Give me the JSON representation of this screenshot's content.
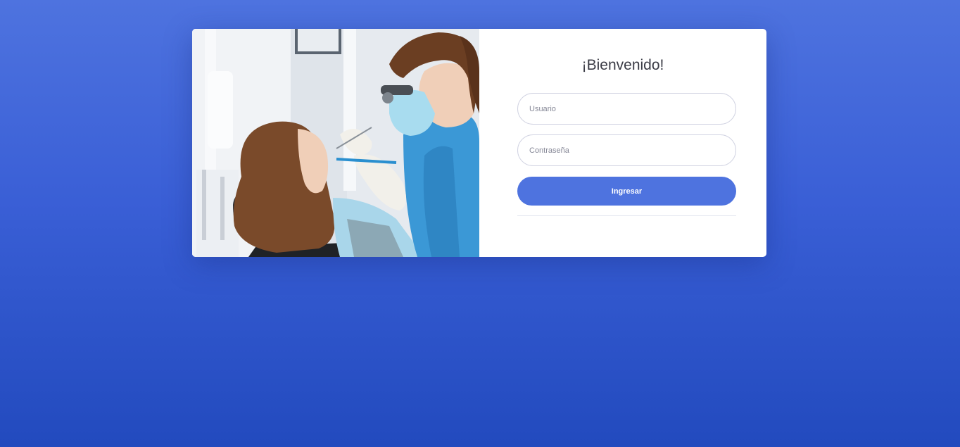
{
  "login": {
    "title": "¡Bienvenido!",
    "username_placeholder": "Usuario",
    "username_value": "",
    "password_placeholder": "Contraseña",
    "password_value": "",
    "submit_label": "Ingresar"
  },
  "image": {
    "subject": "dentist examining patient"
  },
  "colors": {
    "background_top": "#4e73df",
    "background_bottom": "#224abe",
    "primary": "#4e73df",
    "card": "#ffffff"
  }
}
